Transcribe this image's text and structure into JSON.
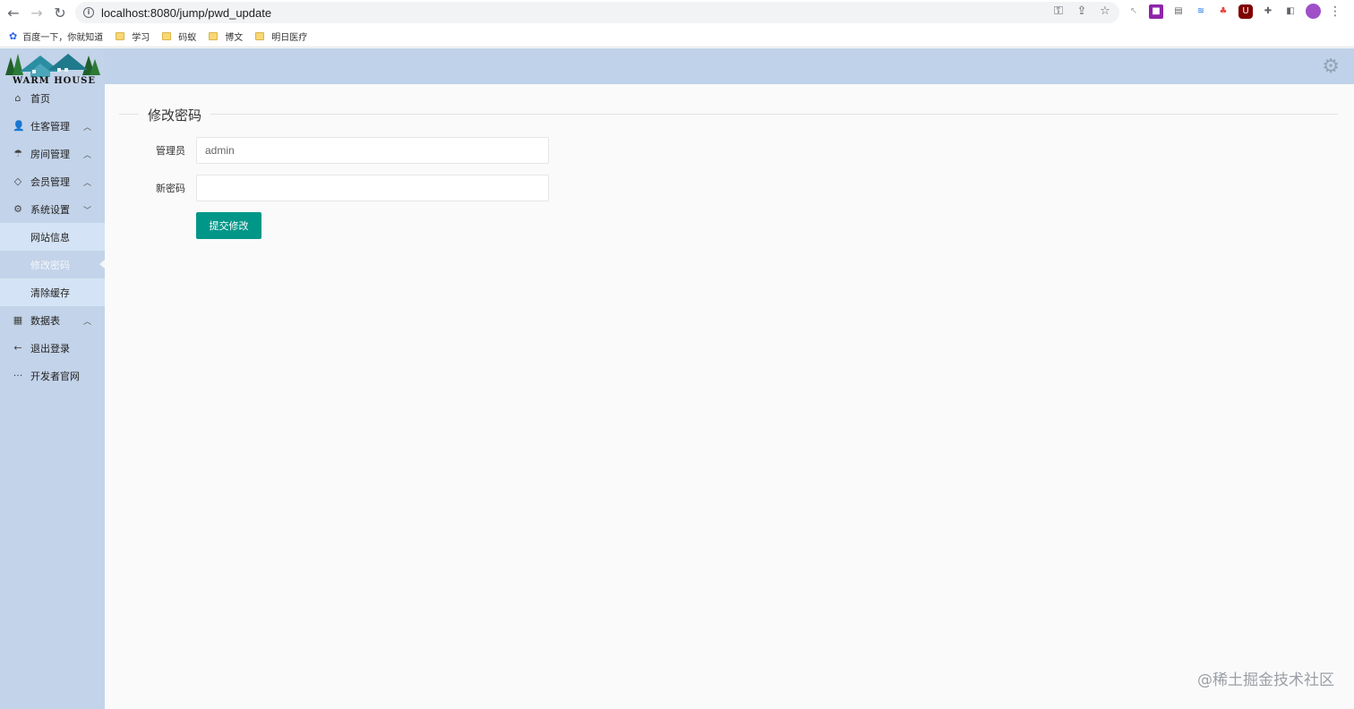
{
  "browser": {
    "url": "localhost:8080/jump/pwd_update",
    "bookmarks": [
      {
        "label": "百度一下，你就知道",
        "icon": "paw-icon"
      },
      {
        "label": "学习",
        "icon": "folder-icon"
      },
      {
        "label": "码蚁",
        "icon": "folder-icon"
      },
      {
        "label": "博文",
        "icon": "folder-icon"
      },
      {
        "label": "明日医疗",
        "icon": "folder-icon"
      }
    ]
  },
  "logo": {
    "text": "WARM HOUSE"
  },
  "sidebar": {
    "items": [
      {
        "label": "首页",
        "icon": "home-icon"
      },
      {
        "label": "住客管理",
        "icon": "user-icon",
        "chevron": "up"
      },
      {
        "label": "房间管理",
        "icon": "umbrella-icon",
        "chevron": "up"
      },
      {
        "label": "会员管理",
        "icon": "diamond-icon",
        "chevron": "up"
      },
      {
        "label": "系统设置",
        "icon": "gear-icon",
        "chevron": "down"
      }
    ],
    "sub_items": [
      "网站信息",
      "修改密码",
      "清除缓存"
    ],
    "tail_items": [
      {
        "label": "数据表",
        "icon": "table-icon",
        "chevron": "up"
      },
      {
        "label": "退出登录",
        "icon": "arrow-left-icon"
      },
      {
        "label": "开发者官网",
        "icon": "more-icon"
      }
    ]
  },
  "form": {
    "legend": "修改密码",
    "admin_label": "管理员",
    "admin_value": "admin",
    "new_password_label": "新密码",
    "new_password_value": "",
    "submit_label": "提交修改"
  },
  "watermark": "@稀土掘金技术社区",
  "colors": {
    "accent": "#009688",
    "header": "#bfd2e9",
    "sidebar": "#c3d3e9"
  }
}
